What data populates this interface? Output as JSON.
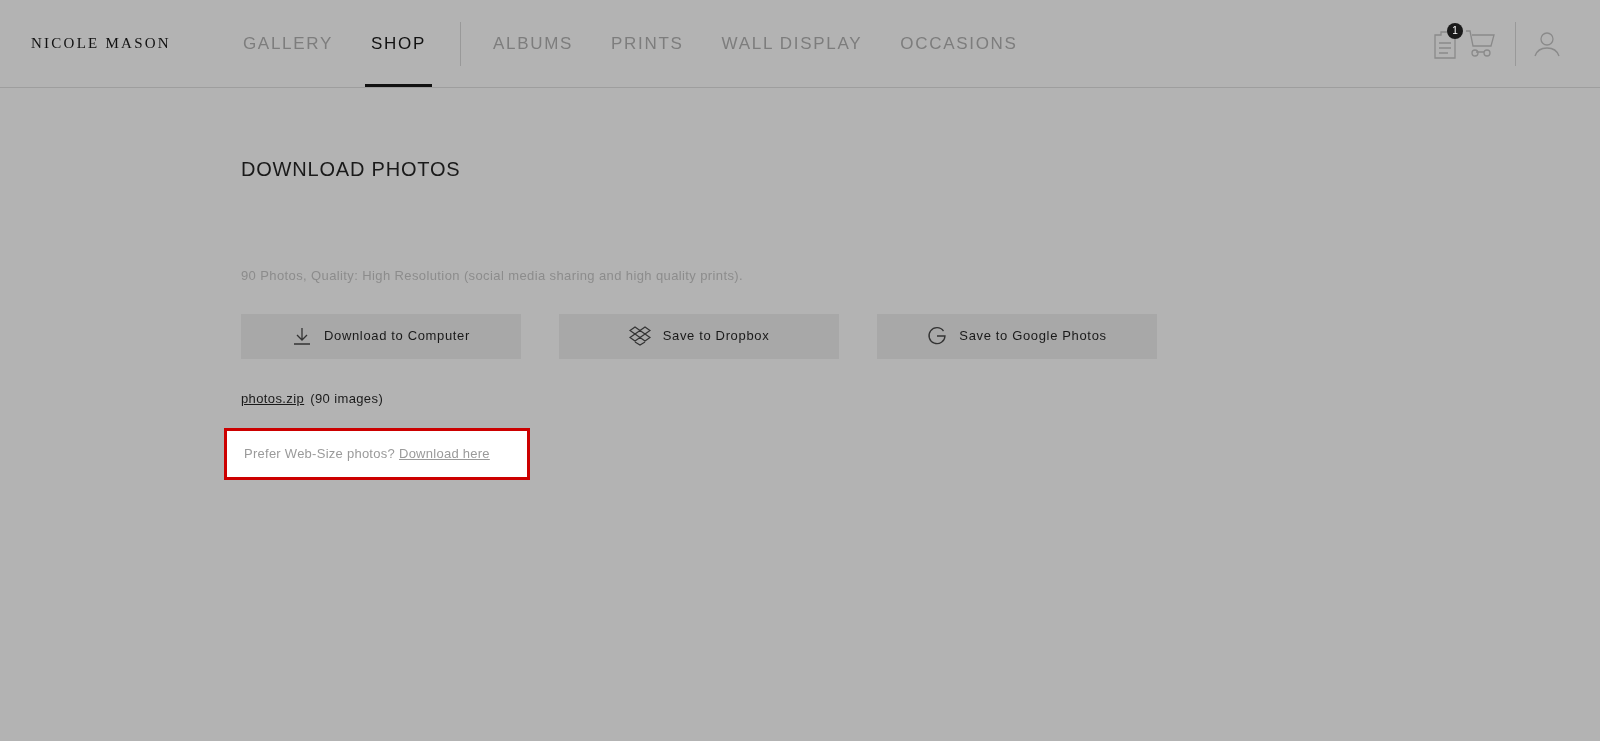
{
  "brand": "NICOLE MASON",
  "nav": [
    {
      "label": "GALLERY",
      "selected": false
    },
    {
      "label": "SHOP",
      "selected": true
    }
  ],
  "subnav": [
    "ALBUMS",
    "PRINTS",
    "WALL DISPLAY",
    "OCCASIONS"
  ],
  "cart_badge": "1",
  "title": "DOWNLOAD PHOTOS",
  "description": "90 Photos, Quality: High Resolution (social media sharing and high quality prints).",
  "buttons": [
    {
      "kind": "download",
      "label": "Download to Computer"
    },
    {
      "kind": "dropbox",
      "label": "Save to Dropbox"
    },
    {
      "kind": "google",
      "label": "Save to Google Photos"
    }
  ],
  "file": {
    "name": "photos.zip",
    "count": "(90 images)"
  },
  "web_size": {
    "prompt": "Prefer Web-Size photos?",
    "link": "Download here",
    "highlighted": true
  }
}
